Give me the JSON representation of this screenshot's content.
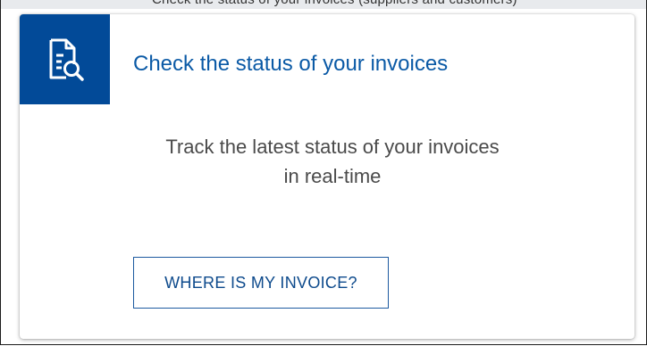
{
  "top_strip": {
    "text": "Check the status of your invoices (suppliers and customers)"
  },
  "card": {
    "icon": "document-search-icon",
    "title": "Check the status of your invoices",
    "description_line1": "Track the latest status of your invoices",
    "description_line2": "in real-time",
    "button_label": "WHERE IS MY INVOICE?"
  },
  "colors": {
    "icon_background": "#024a98",
    "title": "#0b5aa6",
    "button_border": "#1d5aa0",
    "description_text": "#4a4a4a"
  }
}
